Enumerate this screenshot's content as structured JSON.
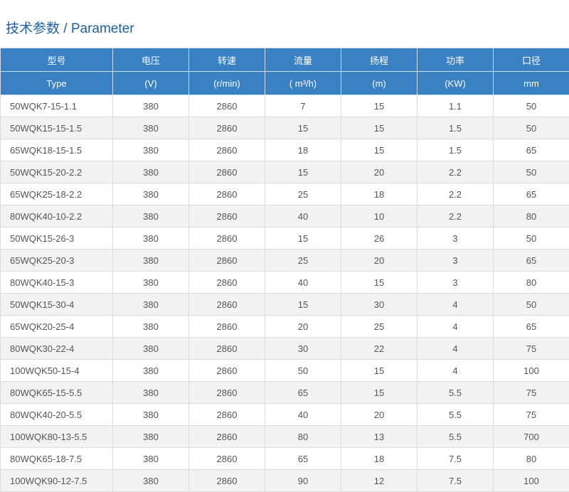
{
  "title": "技术参数 / Parameter",
  "table": {
    "headers_cn": [
      "型号",
      "电压",
      "转速",
      "流量",
      "扬程",
      "功率",
      "口径"
    ],
    "headers_unit": [
      "Type",
      "(V)",
      "(r/min)",
      "( m³/h)",
      "(m)",
      "(KW)",
      "mm"
    ],
    "rows": [
      [
        "50WQK7-15-1.1",
        "380",
        "2860",
        "7",
        "15",
        "1.1",
        "50"
      ],
      [
        "50WQK15-15-1.5",
        "380",
        "2860",
        "15",
        "15",
        "1.5",
        "50"
      ],
      [
        "65WQK18-15-1.5",
        "380",
        "2860",
        "18",
        "15",
        "1.5",
        "65"
      ],
      [
        "50WQK15-20-2.2",
        "380",
        "2860",
        "15",
        "20",
        "2.2",
        "50"
      ],
      [
        "65WQK25-18-2.2",
        "380",
        "2860",
        "25",
        "18",
        "2.2",
        "65"
      ],
      [
        "80WQK40-10-2.2",
        "380",
        "2860",
        "40",
        "10",
        "2.2",
        "80"
      ],
      [
        "50WQK15-26-3",
        "380",
        "2860",
        "15",
        "26",
        "3",
        "50"
      ],
      [
        "65WQK25-20-3",
        "380",
        "2860",
        "25",
        "20",
        "3",
        "65"
      ],
      [
        "80WQK40-15-3",
        "380",
        "2860",
        "40",
        "15",
        "3",
        "80"
      ],
      [
        "50WQK15-30-4",
        "380",
        "2860",
        "15",
        "30",
        "4",
        "50"
      ],
      [
        "65WQK20-25-4",
        "380",
        "2860",
        "20",
        "25",
        "4",
        "65"
      ],
      [
        "80WQK30-22-4",
        "380",
        "2860",
        "30",
        "22",
        "4",
        "75"
      ],
      [
        "100WQK50-15-4",
        "380",
        "2860",
        "50",
        "15",
        "4",
        "100"
      ],
      [
        "80WQK65-15-5.5",
        "380",
        "2860",
        "65",
        "15",
        "5.5",
        "75"
      ],
      [
        "80WQK40-20-5.5",
        "380",
        "2860",
        "40",
        "20",
        "5.5",
        "75"
      ],
      [
        "100WQK80-13-5.5",
        "380",
        "2860",
        "80",
        "13",
        "5.5",
        "700"
      ],
      [
        "80WQK65-18-7.5",
        "380",
        "2860",
        "65",
        "18",
        "7.5",
        "80"
      ],
      [
        "100WQK90-12-7.5",
        "380",
        "2860",
        "90",
        "12",
        "7.5",
        "100"
      ]
    ]
  }
}
